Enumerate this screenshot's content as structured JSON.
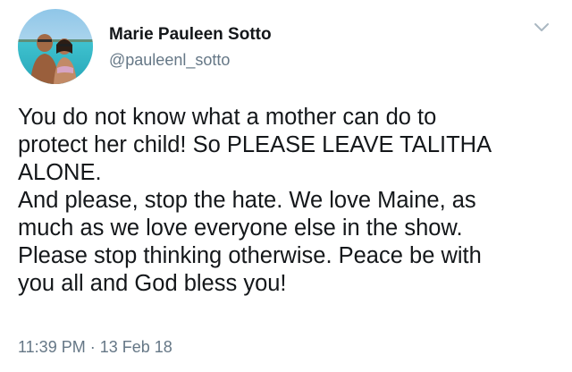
{
  "tweet": {
    "author": {
      "display_name": "Marie Pauleen Sotto",
      "handle": "@pauleenl_sotto"
    },
    "text_lines": [
      "You do not know what a mother can do to",
      "protect her child! So PLEASE LEAVE TALITHA",
      "ALONE.",
      "And please, stop the hate. We love Maine, as",
      "much as we love everyone else in the show.",
      "Please stop thinking otherwise. Peace be with",
      "you all and God bless you!"
    ],
    "timestamp": "11:39 PM · 13 Feb 18"
  },
  "icons": {
    "menu": "chevron-down-icon",
    "avatar": "avatar"
  },
  "colors": {
    "text_primary": "#14171a",
    "text_secondary": "#657786",
    "chevron": "#aab8c2",
    "background": "#ffffff"
  }
}
